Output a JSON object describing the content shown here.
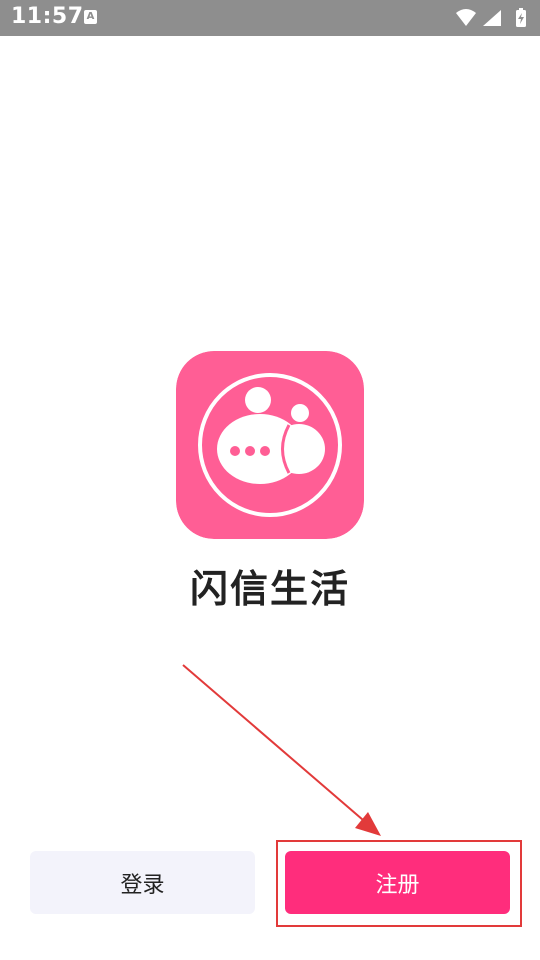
{
  "status_bar": {
    "time": "11:57",
    "notification_icon": "a-letter-icon",
    "icons": [
      "wifi-icon",
      "signal-icon",
      "battery-icon"
    ],
    "background_color": "#8e8e8e"
  },
  "app": {
    "name": "闪信生活",
    "logo_icon": "chat-bubble-logo",
    "brand_color": "#ff5e95"
  },
  "actions": {
    "login_label": "登录",
    "register_label": "注册",
    "register_color": "#ff2d7c",
    "login_color": "#f3f3fb"
  },
  "annotation": {
    "highlight_color": "#e23a3a"
  }
}
